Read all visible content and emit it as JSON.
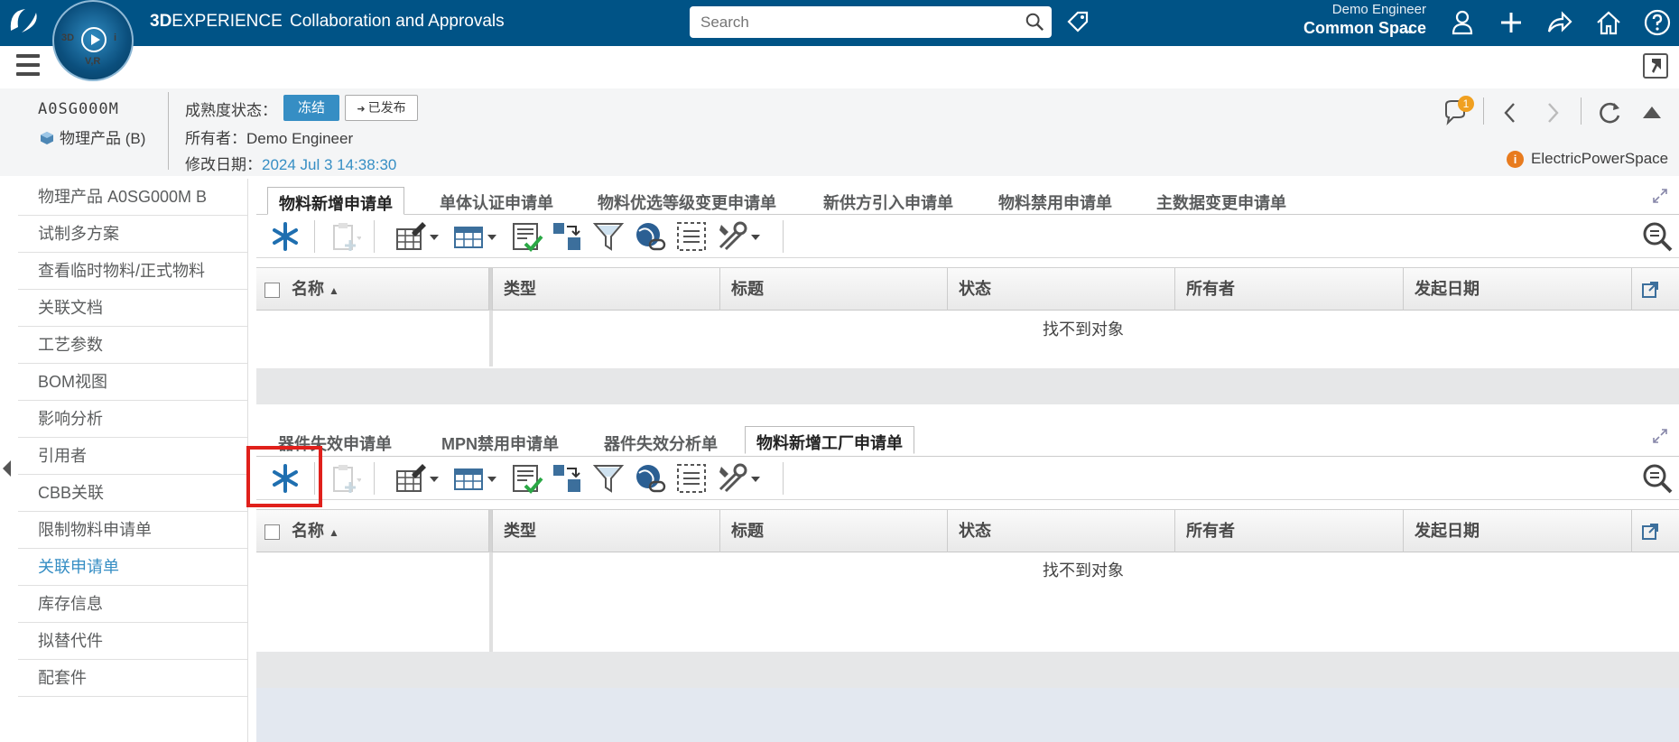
{
  "topbar": {
    "brand_bold": "3D",
    "brand_rest": "EXPERIENCE",
    "app_title": "Collaboration and Approvals",
    "search_placeholder": "Search",
    "user_name": "Demo Engineer",
    "space_name": "Common Space",
    "compass": {
      "left": "3D",
      "bottom": "V,R",
      "right": "i"
    }
  },
  "object": {
    "id": "A0SG000M",
    "type_label": "物理产品 (B)",
    "maturity_label": "成熟度状态：",
    "state_current": "冻结",
    "state_next": "已发布",
    "owner_label": "所有者：Demo Engineer",
    "modified_label": "修改日期：",
    "modified_value": "2024 Jul 3 14:38:30",
    "notification_count": "1",
    "collab_space": "ElectricPowerSpace"
  },
  "sidebar": {
    "items": [
      {
        "label": "物理产品 A0SG000M B",
        "active": false
      },
      {
        "label": "试制多方案",
        "active": false
      },
      {
        "label": "查看临时物料/正式物料",
        "active": false
      },
      {
        "label": "关联文档",
        "active": false
      },
      {
        "label": "工艺参数",
        "active": false
      },
      {
        "label": "BOM视图",
        "active": false
      },
      {
        "label": "影响分析",
        "active": false
      },
      {
        "label": "引用者",
        "active": false
      },
      {
        "label": "CBB关联",
        "active": false
      },
      {
        "label": "限制物料申请单",
        "active": false
      },
      {
        "label": "关联申请单",
        "active": true
      },
      {
        "label": "库存信息",
        "active": false
      },
      {
        "label": "拟替代件",
        "active": false
      },
      {
        "label": "配套件",
        "active": false
      }
    ]
  },
  "panel_top": {
    "tabs": [
      "物料新增申请单",
      "单体认证申请单",
      "物料优选等级变更申请单",
      "新供方引入申请单",
      "物料禁用申请单",
      "主数据变更申请单"
    ],
    "selected_tab": 0,
    "columns": [
      "名称",
      "类型",
      "标题",
      "状态",
      "所有者",
      "发起日期"
    ],
    "empty_text": "找不到对象"
  },
  "panel_bottom": {
    "tabs": [
      "器件失效申请单",
      "MPN禁用申请单",
      "器件失效分析单",
      "物料新增工厂申请单"
    ],
    "selected_tab": 3,
    "columns": [
      "名称",
      "类型",
      "标题",
      "状态",
      "所有者",
      "发起日期"
    ],
    "empty_text": "找不到对象"
  },
  "colors": {
    "topbar": "#005386",
    "accent": "#368ec4",
    "highlight": "#e0201b"
  }
}
